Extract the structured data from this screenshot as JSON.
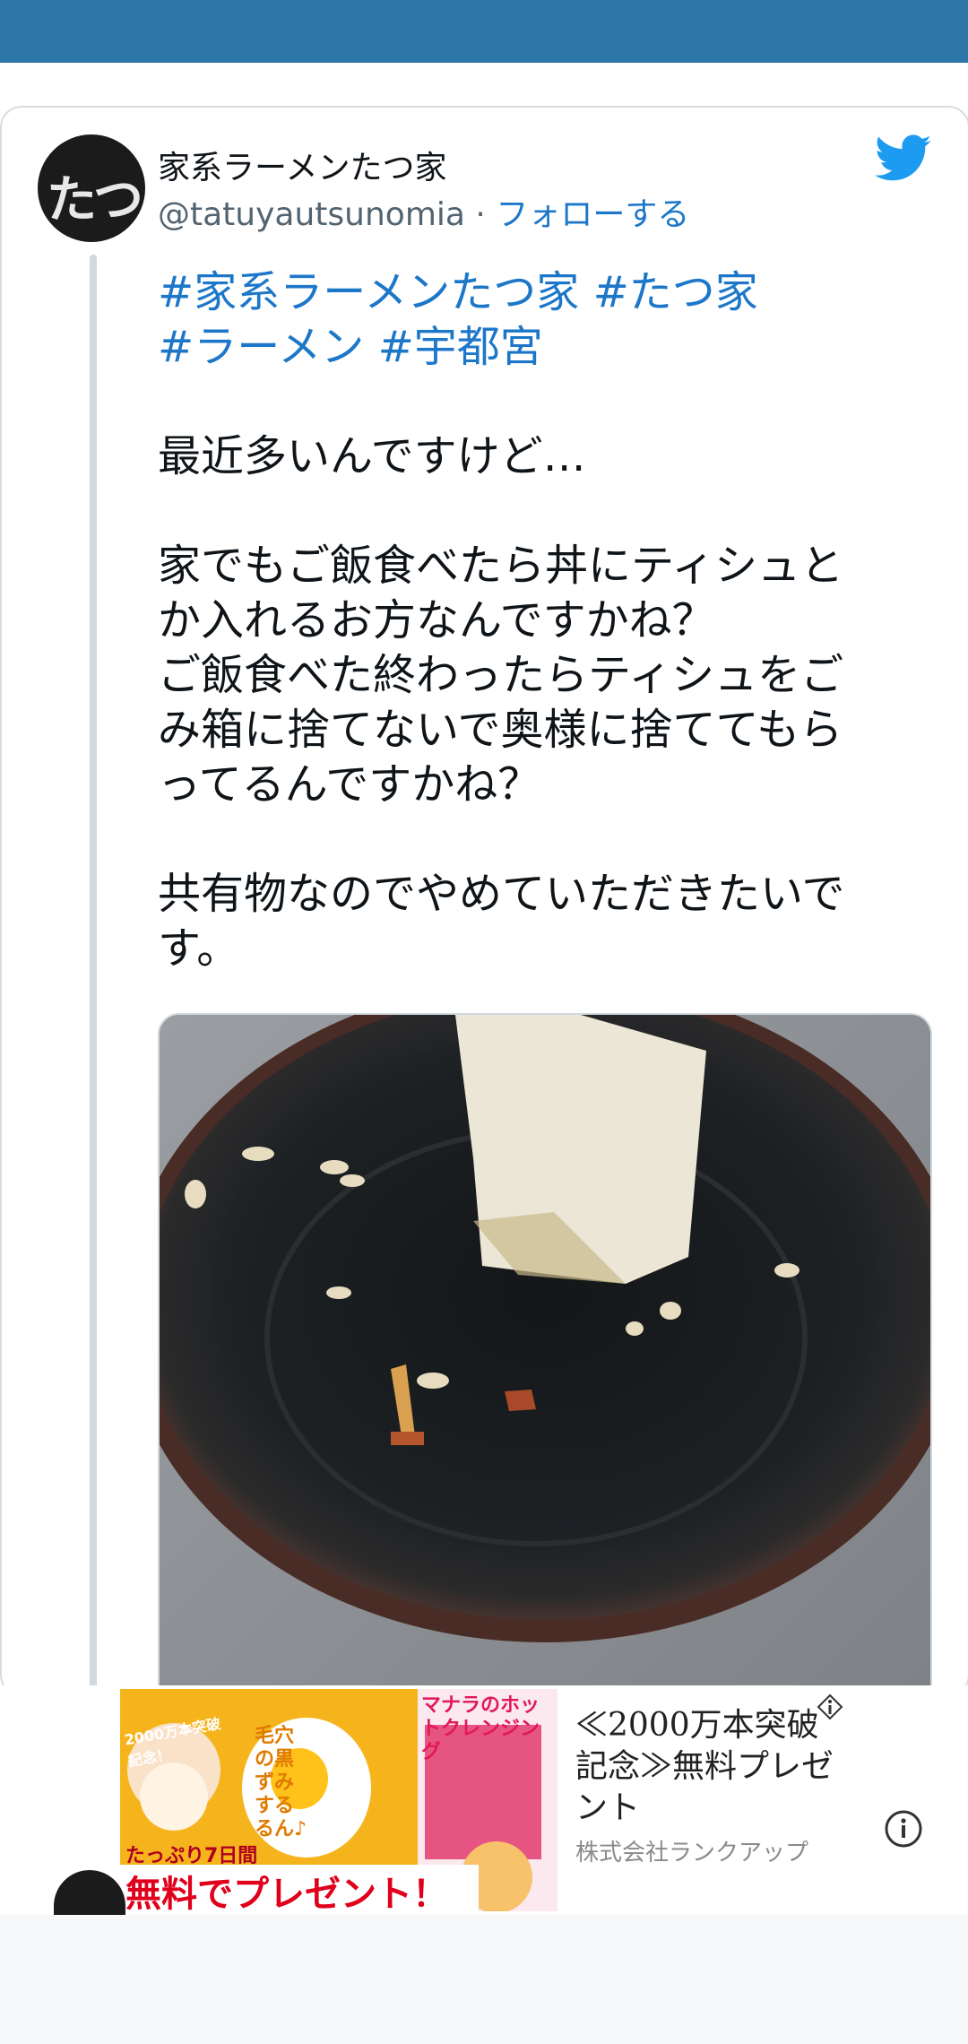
{
  "tweet": {
    "display_name": "家系ラーメンたつ家",
    "handle": "@tatuyautsunomia",
    "separator": "·",
    "follow_label": "フォローする",
    "avatar_glyph": "たつ家",
    "hashtags_line1": [
      "#家系ラーメンたつ家",
      "#たつ家"
    ],
    "hashtags_line2": [
      "#ラーメン",
      "#宇都宮"
    ],
    "body": {
      "p1": "最近多いんですけど…",
      "p2_l1": "家でもご飯食べたら丼にティシュと",
      "p2_l2": "か入れるお方なんですかね？",
      "p2_l3": "ご飯食べた終わったらティシュをご",
      "p2_l4": "み箱に捨てないで奥様に捨ててもら",
      "p2_l5": "ってるんですかね？",
      "p3_l1": "共有物なのでやめていただきたいで",
      "p3_l2": "す。"
    },
    "icons": {
      "platform": "twitter-bird-icon"
    },
    "colors": {
      "link": "#1d77c9",
      "topbar": "#2d77a8"
    }
  },
  "ad": {
    "title": "≪2000万本突破記念≫無料プレゼント",
    "company": "株式会社ランクアップ",
    "banner": {
      "badge": "2000万本突破記念！",
      "brand": "マナラのホットクレンジング",
      "copy": "毛穴の黒ずみするるん♪",
      "duration": "たっぷり7日間",
      "cta": "無料でプレゼント！"
    }
  }
}
